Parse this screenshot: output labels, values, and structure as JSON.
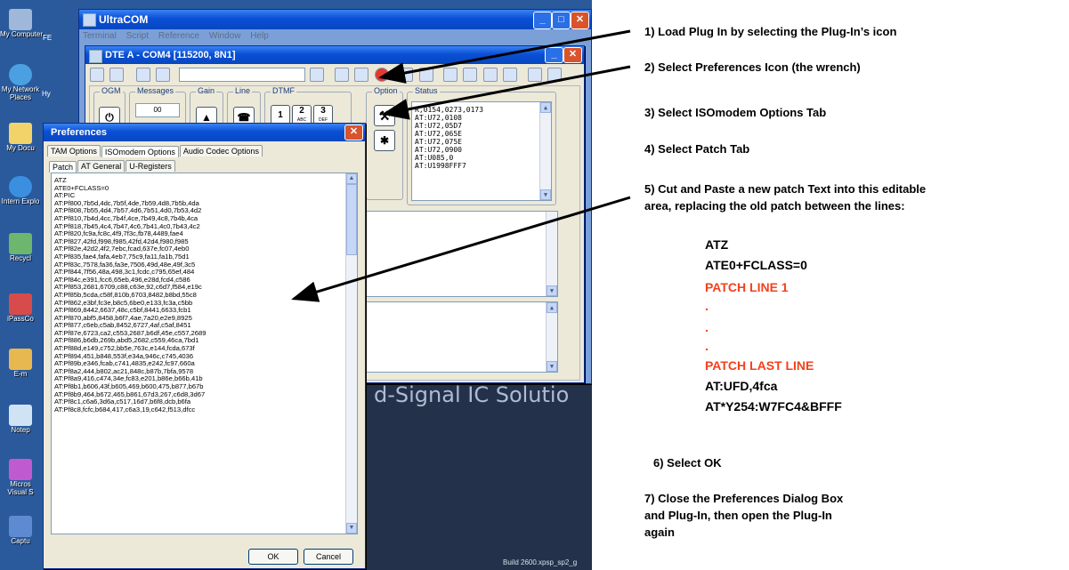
{
  "desktop": {
    "icons": [
      {
        "label": "My Computer",
        "icon": "computer-icon"
      },
      {
        "label": "My Network Places",
        "icon": "network-icon"
      },
      {
        "label": "My Docu",
        "icon": "folder-icon"
      },
      {
        "label": "Intern Explo",
        "icon": "ie-icon"
      },
      {
        "label": "Recycl",
        "icon": "recycle-bin-icon"
      },
      {
        "label": "iPassCo",
        "icon": "app-icon"
      },
      {
        "label": "E-m",
        "icon": "mail-icon"
      },
      {
        "label": "Notep",
        "icon": "notepad-icon"
      },
      {
        "label": "Micros Visual S",
        "icon": "visual-studio-icon"
      },
      {
        "label": "Captu",
        "icon": "capture-icon"
      }
    ],
    "side_labels": [
      "FE",
      "Hy"
    ],
    "brand_text": "d-Signal IC Solutio",
    "build_text": "Build 2600.xpsp_sp2_g"
  },
  "ultracom": {
    "title": "UltraCOM",
    "menu": [
      "Terminal",
      "Script",
      "Reference",
      "Window",
      "Help"
    ],
    "dte": {
      "title": "DTE A - COM4 [115200, 8N1]",
      "groups": {
        "ogm": "OGM",
        "messages": "Messages",
        "gain": "Gain",
        "line": "Line",
        "dtmf": "DTMF",
        "option": "Option",
        "status": "Status"
      },
      "messages_value": "00",
      "dtmf_keys": [
        {
          "num": "1",
          "sub": ""
        },
        {
          "num": "2",
          "sub": "ABC"
        },
        {
          "num": "3",
          "sub": "DEF"
        }
      ],
      "status_lines": [
        "R,0154,0273,0173",
        "AT:U72,0108",
        "AT:U72,05D7",
        "AT:U72,065E",
        "AT:U72,075E",
        "AT:U72,0900",
        "AT:U085,0",
        "AT:U1998FFF7"
      ]
    }
  },
  "preferences": {
    "title": "Preferences",
    "top_tabs": [
      "TAM Options",
      "ISOmodem Options",
      "Audio Codec Options"
    ],
    "sub_tabs": [
      "Patch",
      "AT General",
      "U-Registers"
    ],
    "patch_lines": [
      "ATZ",
      "ATE0+FCLASS=0",
      "AT:PIC",
      "AT:Pf800,7b5d,4dc,7b5f,4de,7b59,4d8,7b5b,4da",
      "AT:Pf808,7b55,4d4,7b57,4d6,7b51,4d0,7b53,4d2",
      "AT:Pf810,7b4d,4cc,7b4f,4ce,7b49,4c8,7b4b,4ca",
      "AT:Pf818,7b45,4c4,7b47,4c6,7b41,4c0,7b43,4c2",
      "AT:Pf820,fc9a,fc8c,4f9,7f3c,fb78,4489,fae4",
      "AT:Pf827,42fd,f998,f985,42fd,42d4,f980,f985",
      "AT:Pf82e,42d2,4f2,7ebc,fcad,637e,fc07,4eb0",
      "AT:Pf835,fae4,fafa,4eb7,75c9,fa11,fa1b,75d1",
      "AT:Pf83c,7578,fa36,fa3e,7506,49d,48e,49f,3c5",
      "AT:Pf844,7f56,48a,498,3c1,fcdc,c795,65ef,484",
      "AT:Pf84c,e391,fcc6,65eb,496,e28d,fcd4,c586",
      "AT:Pf853,2681,6709,c88,c63e,92,c6d7,f584,e19c",
      "AT:Pf85b,5cda,c58f,810b,6703,8482,b8bd,55c8",
      "AT:Pf862,e3bf,fc3e,b8c5,6be0,e133,fc3a,c5bb",
      "AT:Pf869,8442,6637,48c,c5bf,8441,6633,fcb1",
      "AT:Pf870,abf5,8458,b6f7,4ae,7a20,e2e9,8925",
      "AT:Pf877,c6eb,c5ab,8452,6727,4af,c5af,8451",
      "AT:Pf87e,6723,ca2,c553,2687,b6df,45e,c557,2689",
      "AT:Pf886,b6db,269b,abd5,2682,c559,46ca,7bd1",
      "AT:Pf88d,e149,c752,bb5e,763c,e144,fcda,673f",
      "AT:Pf894,451,b848,553f,e34a,946c,c745,4036",
      "AT:Pf89b,e346,fcab,c741,4835,e242,fc97,660a",
      "AT:Pf8a2,444,b802,ac21,848c,b87b,7bfa,9578",
      "AT:Pf8a9,416,c474,34e,fc83,e201,b86e,b66b,41b",
      "AT:Pf8b1,b606,43f,b605,469,b600,475,b877,b67b",
      "AT:Pf8b9,464,b672,465,b861,67d3,267,c6d8,3d67",
      "AT:Pf8c1,c6a6,3d6a,c517,16d7,b6f8,dcb,b6fa",
      "AT:Pf8c8,fcfc,b684,417,c6a3,19,c642,f513,dfcc"
    ],
    "ok_label": "OK",
    "cancel_label": "Cancel"
  },
  "annotations": {
    "steps": [
      "1) Load Plug In by selecting the Plug-In’s icon",
      "2) Select Preferences Icon (the wrench)",
      "3) Select ISOmodem Options Tab",
      "4) Select Patch Tab",
      "5) Cut and Paste a new patch Text into this editable",
      "area, replacing the old patch between the lines:",
      "6) Select OK",
      "7) Close the Preferences Dialog Box",
      "and Plug-In, then open the Plug-In",
      "again"
    ],
    "code": [
      "ATZ",
      "ATE0+FCLASS=0",
      "PATCH LINE 1",
      ".",
      ".",
      ".",
      "PATCH LAST LINE",
      "AT:UFD,4fca",
      "AT*Y254:W7FC4&BFFF"
    ],
    "red_color": "#f3411c"
  }
}
